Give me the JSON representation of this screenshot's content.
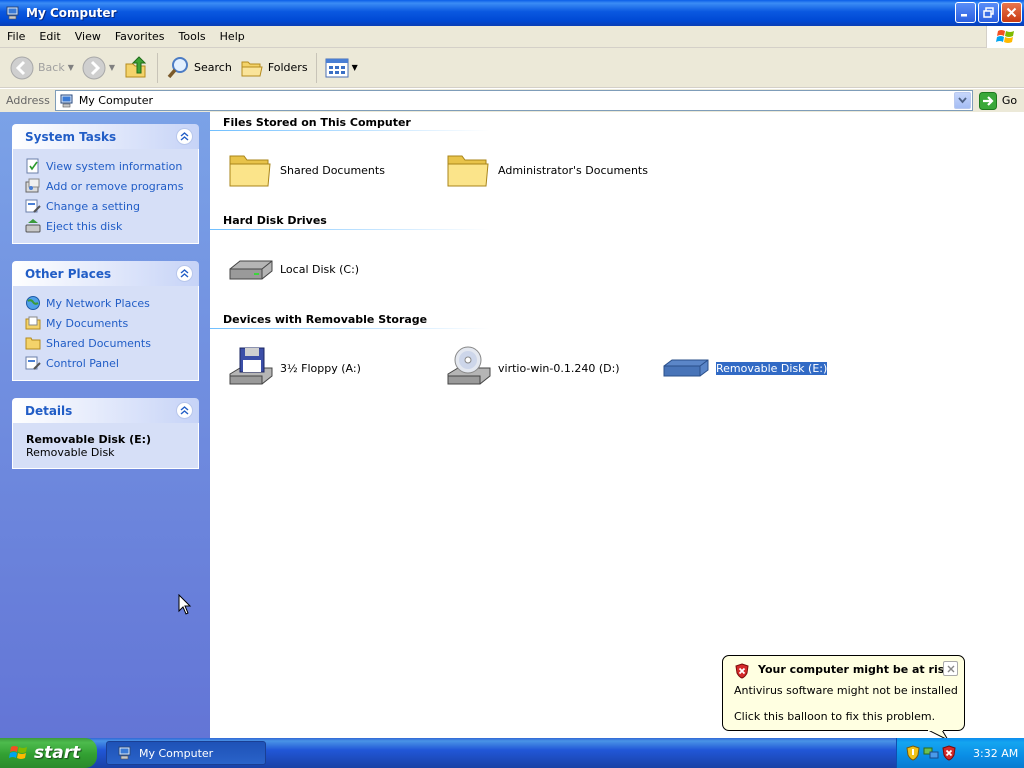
{
  "window": {
    "title": "My Computer"
  },
  "menubar": {
    "items": [
      "File",
      "Edit",
      "View",
      "Favorites",
      "Tools",
      "Help"
    ]
  },
  "toolbar": {
    "back_label": "Back",
    "search_label": "Search",
    "folders_label": "Folders"
  },
  "address": {
    "label": "Address",
    "value": "My Computer",
    "go_label": "Go"
  },
  "left_panel": {
    "system_tasks": {
      "title": "System Tasks",
      "items": [
        "View system information",
        "Add or remove programs",
        "Change a setting",
        "Eject this disk"
      ]
    },
    "other_places": {
      "title": "Other Places",
      "items": [
        "My Network Places",
        "My Documents",
        "Shared Documents",
        "Control Panel"
      ]
    },
    "details": {
      "title": "Details",
      "name": "Removable Disk (E:)",
      "type": "Removable Disk"
    }
  },
  "content": {
    "groups": [
      {
        "title": "Files Stored on This Computer",
        "items": [
          "Shared Documents",
          "Administrator's Documents"
        ]
      },
      {
        "title": "Hard Disk Drives",
        "items": [
          "Local Disk (C:)"
        ]
      },
      {
        "title": "Devices with Removable Storage",
        "items": [
          "3½ Floppy (A:)",
          "virtio-win-0.1.240 (D:)",
          "Removable Disk (E:)"
        ]
      }
    ]
  },
  "balloon": {
    "title": "Your computer might be at risk",
    "line1": "Antivirus software might not be installed",
    "line2": "Click this balloon to fix this problem."
  },
  "taskbar": {
    "start_label": "start",
    "window_label": "My Computer",
    "clock": "3:32 AM"
  },
  "colors": {
    "titlebar": "#0a58e0",
    "task_link": "#215dc6",
    "selection": "#316ac5",
    "balloon_bg": "#ffffe1"
  }
}
